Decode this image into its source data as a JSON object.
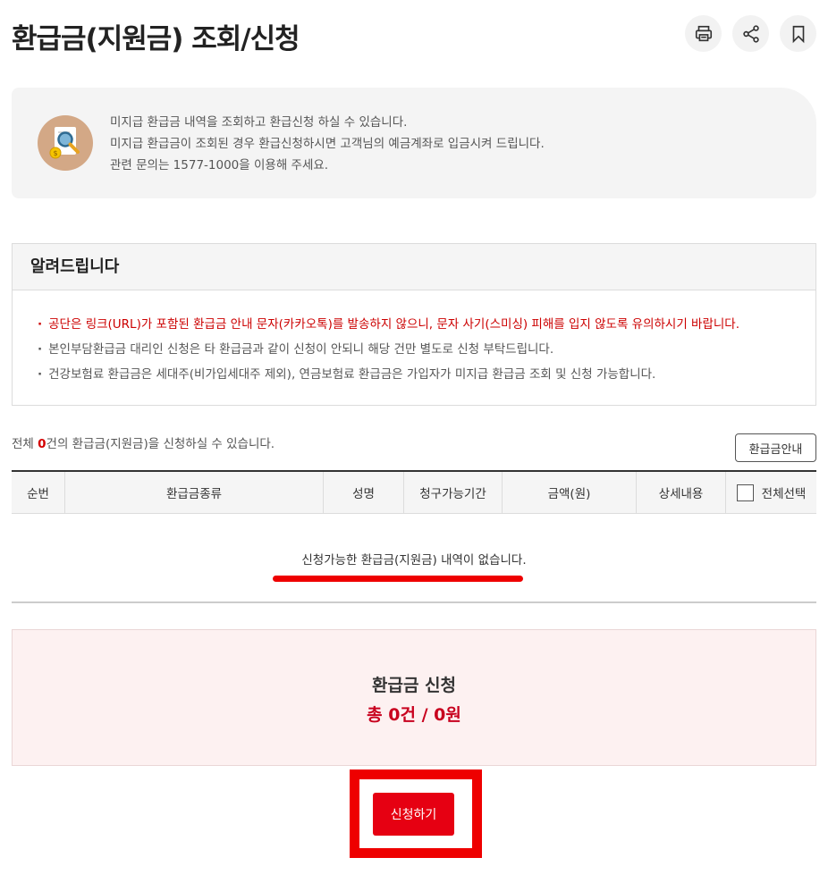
{
  "page": {
    "title": "환급금(지원금) 조회/신청"
  },
  "top_actions": [
    {
      "icon": "print-icon"
    },
    {
      "icon": "share-icon"
    },
    {
      "icon": "bookmark-icon"
    }
  ],
  "info": {
    "icon": "search-document-icon",
    "lines": [
      "미지급 환급금 내역을 조회하고 환급신청 하실 수 있습니다.",
      "미지급 환급금이 조회된 경우 환급신청하시면 고객님의 예금계좌로 입금시켜 드립니다.",
      "관련 문의는 1577-1000을 이용해 주세요."
    ]
  },
  "notice": {
    "title": "알려드립니다",
    "items": [
      "공단은 링크(URL)가 포함된 환급금 안내 문자(카카오톡)를 발송하지 않으니, 문자 사기(스미싱) 피해를 입지 않도록 유의하시기 바랍니다.",
      "본인부담환급금 대리인 신청은 타 환급금과 같이 신청이 안되니 해당 건만 별도로 신청 부탁드립니다.",
      "건강보험료 환급금은 세대주(비가입세대주 제외), 연금보험료 환급금은 가입자가 미지급 환급금 조회 및 신청 가능합니다."
    ],
    "highlight_color": "#cc0000"
  },
  "summary_line": {
    "prefix": "전체 ",
    "count": "0",
    "suffix": "건의 환급금(지원금)을 신청하실 수 있습니다."
  },
  "guide_button": "환급금안내",
  "table": {
    "columns": [
      "순번",
      "환급금종류",
      "성명",
      "청구가능기간",
      "금액(원)",
      "상세내용",
      "전체선택"
    ],
    "empty_message": "신청가능한 환급금(지원금) 내역이 없습니다."
  },
  "apply_summary": {
    "title": "환급금 신청",
    "total": "총 0건 / 0원"
  },
  "apply_button": "신청하기",
  "colors": {
    "accent_red": "#e60012",
    "annotation_red": "#ee0000"
  }
}
